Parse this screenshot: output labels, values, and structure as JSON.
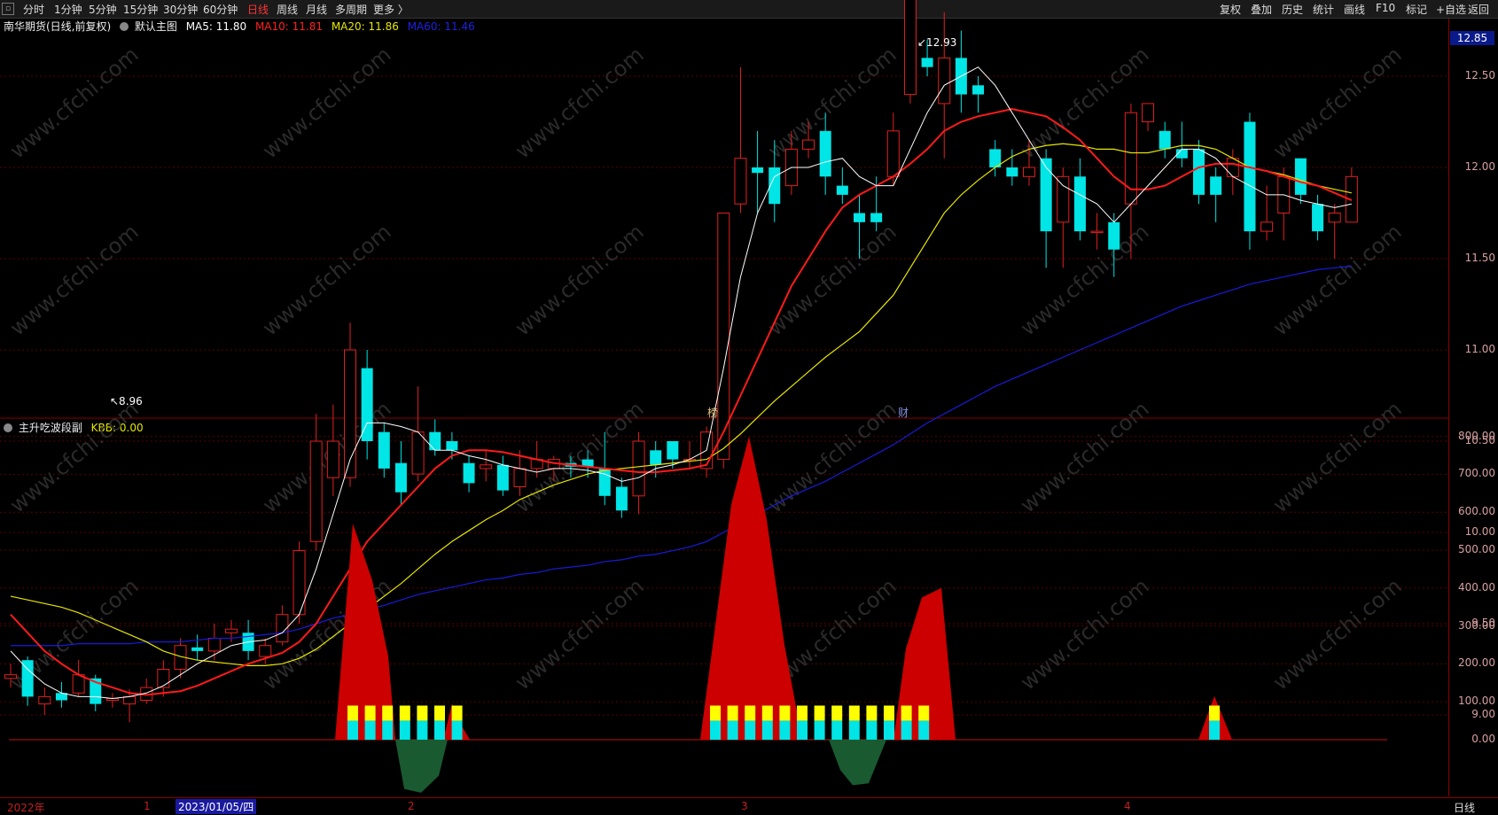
{
  "toolbar": {
    "left_items": [
      "分时",
      "1分钟",
      "5分钟",
      "15分钟",
      "30分钟",
      "60分钟",
      "日线",
      "周线",
      "月线",
      "多周期",
      "更多 〉"
    ],
    "active": "日线",
    "right_items": [
      "复权",
      "叠加",
      "历史",
      "统计",
      "画线",
      "F10",
      "标记",
      "+自选",
      "返回"
    ]
  },
  "main_chart": {
    "title": "南华期货(日线,前复权)",
    "indicator_name": "默认主图",
    "ma5": "MA5: 11.80",
    "ma10": "MA10: 11.81",
    "ma20": "MA20: 11.86",
    "ma60": "MA60: 11.46",
    "high_label": "12.93",
    "low_label": "8.96",
    "current_price": "12.85",
    "y_ticks": [
      "12.50",
      "12.00",
      "11.50",
      "11.00",
      "10.50",
      "10.00",
      "9.50",
      "9.00"
    ],
    "markers": [
      "榜",
      "财"
    ],
    "colors": {
      "up": "#e02020",
      "down": "#00e5e5",
      "ma5": "#ffffff",
      "ma10": "#ff1a1a",
      "ma20": "#e6e600",
      "ma60": "#1a1adb"
    }
  },
  "sub_chart": {
    "title": "主升吃波段副",
    "kbb": "KBB: 0.00",
    "y_ticks": [
      "800.00",
      "700.00",
      "600.00",
      "500.00",
      "400.00",
      "300.00",
      "200.00",
      "100.00",
      "0.00"
    ]
  },
  "time_axis": {
    "year": "2022年",
    "labels": [
      "1",
      "2",
      "3",
      "4"
    ],
    "selected_date": "2023/01/05/四",
    "period": "日线"
  },
  "watermark": "www.cfchi.com",
  "candles": [
    [
      9.2,
      9.22,
      9.15,
      9.28
    ],
    [
      9.3,
      9.1,
      9.05,
      9.32
    ],
    [
      9.06,
      9.1,
      9.0,
      9.15
    ],
    [
      9.12,
      9.08,
      9.04,
      9.18
    ],
    [
      9.12,
      9.22,
      9.1,
      9.3
    ],
    [
      9.2,
      9.06,
      9.02,
      9.22
    ],
    [
      9.08,
      9.09,
      9.04,
      9.12
    ],
    [
      9.06,
      9.1,
      8.96,
      9.14
    ],
    [
      9.08,
      9.15,
      9.06,
      9.2
    ],
    [
      9.15,
      9.25,
      9.1,
      9.3
    ],
    [
      9.25,
      9.38,
      9.2,
      9.42
    ],
    [
      9.37,
      9.35,
      9.3,
      9.44
    ],
    [
      9.35,
      9.42,
      9.3,
      9.5
    ],
    [
      9.45,
      9.47,
      9.4,
      9.52
    ],
    [
      9.45,
      9.35,
      9.3,
      9.52
    ],
    [
      9.32,
      9.38,
      9.28,
      9.42
    ],
    [
      9.4,
      9.55,
      9.38,
      9.6
    ],
    [
      9.55,
      9.9,
      9.5,
      9.95
    ],
    [
      9.95,
      10.5,
      9.9,
      10.65
    ],
    [
      10.3,
      10.5,
      10.2,
      10.7
    ],
    [
      10.3,
      11.0,
      10.25,
      11.15
    ],
    [
      10.9,
      10.5,
      10.4,
      11.0
    ],
    [
      10.55,
      10.35,
      10.3,
      10.6
    ],
    [
      10.38,
      10.22,
      10.15,
      10.5
    ],
    [
      10.32,
      10.55,
      10.28,
      10.8
    ],
    [
      10.55,
      10.45,
      10.42,
      10.62
    ],
    [
      10.5,
      10.45,
      10.4,
      10.55
    ],
    [
      10.38,
      10.27,
      10.22,
      10.42
    ],
    [
      10.35,
      10.37,
      10.28,
      10.45
    ],
    [
      10.37,
      10.23,
      10.2,
      10.42
    ],
    [
      10.25,
      10.35,
      10.2,
      10.45
    ],
    [
      10.35,
      10.4,
      10.3,
      10.5
    ],
    [
      10.35,
      10.4,
      10.28,
      10.42
    ],
    [
      10.38,
      10.36,
      10.3,
      10.42
    ],
    [
      10.4,
      10.36,
      10.3,
      10.45
    ],
    [
      10.35,
      10.2,
      10.15,
      10.55
    ],
    [
      10.25,
      10.12,
      10.08,
      10.3
    ],
    [
      10.2,
      10.5,
      10.1,
      10.55
    ],
    [
      10.45,
      10.37,
      10.3,
      10.5
    ],
    [
      10.5,
      10.4,
      10.35,
      10.5
    ],
    [
      10.4,
      10.4,
      10.35,
      10.5
    ],
    [
      10.35,
      10.55,
      10.3,
      10.58
    ],
    [
      10.4,
      11.75,
      10.35,
      11.75
    ],
    [
      11.8,
      12.05,
      11.75,
      12.55
    ],
    [
      12.0,
      11.97,
      11.75,
      12.2
    ],
    [
      12.0,
      11.8,
      11.7,
      12.15
    ],
    [
      11.9,
      12.1,
      11.85,
      12.2
    ],
    [
      12.1,
      12.15,
      12.05,
      12.25
    ],
    [
      12.2,
      11.95,
      11.85,
      12.3
    ],
    [
      11.9,
      11.85,
      11.8,
      12.0
    ],
    [
      11.75,
      11.7,
      11.5,
      11.85
    ],
    [
      11.75,
      11.7,
      11.65,
      11.95
    ],
    [
      11.95,
      12.2,
      11.9,
      12.3
    ],
    [
      12.4,
      12.93,
      12.35,
      12.93
    ],
    [
      12.6,
      12.55,
      12.5,
      12.7
    ],
    [
      12.35,
      12.6,
      12.05,
      12.85
    ],
    [
      12.6,
      12.4,
      12.3,
      12.75
    ],
    [
      12.45,
      12.4,
      12.3,
      12.5
    ],
    [
      12.1,
      12.0,
      11.95,
      12.15
    ],
    [
      12.0,
      11.95,
      11.9,
      12.1
    ],
    [
      11.95,
      12.0,
      11.9,
      12.15
    ],
    [
      12.05,
      11.65,
      11.45,
      12.1
    ],
    [
      11.7,
      11.95,
      11.45,
      12.0
    ],
    [
      11.95,
      11.65,
      11.6,
      12.05
    ],
    [
      11.65,
      11.65,
      11.55,
      11.75
    ],
    [
      11.7,
      11.55,
      11.4,
      11.75
    ],
    [
      11.8,
      12.3,
      11.5,
      12.35
    ],
    [
      12.25,
      12.35,
      12.2,
      12.35
    ],
    [
      12.2,
      12.1,
      12.05,
      12.25
    ],
    [
      12.1,
      12.05,
      12.0,
      12.25
    ],
    [
      12.1,
      11.85,
      11.8,
      12.15
    ],
    [
      11.95,
      11.85,
      11.7,
      12.0
    ],
    [
      11.95,
      12.05,
      11.85,
      12.1
    ],
    [
      12.25,
      11.65,
      11.55,
      12.3
    ],
    [
      11.65,
      11.7,
      11.6,
      11.9
    ],
    [
      11.75,
      11.95,
      11.6,
      12.0
    ],
    [
      12.05,
      11.85,
      11.8,
      12.05
    ],
    [
      11.8,
      11.65,
      11.6,
      11.85
    ],
    [
      11.7,
      11.75,
      11.5,
      11.8
    ],
    [
      11.7,
      11.95,
      11.7,
      12.0
    ]
  ],
  "ma5": [
    9.35,
    9.25,
    9.17,
    9.12,
    9.1,
    9.1,
    9.09,
    9.1,
    9.12,
    9.16,
    9.22,
    9.28,
    9.33,
    9.38,
    9.4,
    9.41,
    9.45,
    9.55,
    9.8,
    10.1,
    10.4,
    10.6,
    10.6,
    10.58,
    10.55,
    10.45,
    10.45,
    10.42,
    10.4,
    10.37,
    10.35,
    10.33,
    10.35,
    10.35,
    10.34,
    10.32,
    10.28,
    10.3,
    10.35,
    10.37,
    10.4,
    10.45,
    10.9,
    11.4,
    11.75,
    11.95,
    12.0,
    12.0,
    12.03,
    12.05,
    11.95,
    11.9,
    11.9,
    12.1,
    12.3,
    12.45,
    12.5,
    12.55,
    12.45,
    12.3,
    12.15,
    12.0,
    11.9,
    11.85,
    11.8,
    11.7,
    11.8,
    11.9,
    12.0,
    12.1,
    12.1,
    12.05,
    11.95,
    11.9,
    11.85,
    11.85,
    11.82,
    11.8,
    11.78,
    11.8
  ],
  "ma10": [
    9.55,
    9.45,
    9.35,
    9.28,
    9.22,
    9.18,
    9.15,
    9.12,
    9.11,
    9.12,
    9.13,
    9.16,
    9.2,
    9.24,
    9.28,
    9.31,
    9.34,
    9.4,
    9.5,
    9.65,
    9.8,
    9.95,
    10.05,
    10.15,
    10.25,
    10.35,
    10.42,
    10.45,
    10.45,
    10.44,
    10.42,
    10.4,
    10.38,
    10.37,
    10.36,
    10.35,
    10.34,
    10.33,
    10.33,
    10.34,
    10.35,
    10.37,
    10.55,
    10.75,
    10.95,
    11.15,
    11.35,
    11.5,
    11.65,
    11.78,
    11.85,
    11.9,
    11.95,
    12.02,
    12.1,
    12.2,
    12.25,
    12.28,
    12.3,
    12.32,
    12.3,
    12.28,
    12.22,
    12.15,
    12.05,
    11.95,
    11.88,
    11.88,
    11.9,
    11.95,
    12.0,
    12.02,
    12.02,
    12.0,
    11.98,
    11.95,
    11.92,
    11.9,
    11.86,
    11.82
  ],
  "ma20": [
    9.65,
    9.63,
    9.61,
    9.59,
    9.56,
    9.52,
    9.48,
    9.44,
    9.4,
    9.35,
    9.32,
    9.3,
    9.29,
    9.28,
    9.27,
    9.27,
    9.28,
    9.31,
    9.36,
    9.43,
    9.5,
    9.58,
    9.65,
    9.72,
    9.8,
    9.88,
    9.95,
    10.01,
    10.07,
    10.12,
    10.18,
    10.22,
    10.26,
    10.29,
    10.32,
    10.34,
    10.35,
    10.36,
    10.37,
    10.38,
    10.39,
    10.4,
    10.46,
    10.54,
    10.63,
    10.72,
    10.8,
    10.88,
    10.96,
    11.03,
    11.1,
    11.2,
    11.3,
    11.45,
    11.6,
    11.75,
    11.85,
    11.93,
    12.0,
    12.06,
    12.1,
    12.12,
    12.13,
    12.12,
    12.1,
    12.1,
    12.08,
    12.08,
    12.1,
    12.12,
    12.12,
    12.1,
    12.05,
    12.0,
    11.98,
    11.96,
    11.93,
    11.9,
    11.88,
    11.86
  ],
  "ma60": [
    9.38,
    9.38,
    9.38,
    9.38,
    9.39,
    9.39,
    9.39,
    9.39,
    9.4,
    9.4,
    9.4,
    9.41,
    9.42,
    9.42,
    9.43,
    9.44,
    9.45,
    9.47,
    9.5,
    9.53,
    9.55,
    9.58,
    9.6,
    9.63,
    9.66,
    9.68,
    9.7,
    9.72,
    9.74,
    9.75,
    9.77,
    9.78,
    9.8,
    9.81,
    9.82,
    9.84,
    9.85,
    9.87,
    9.88,
    9.9,
    9.92,
    9.95,
    10.0,
    10.05,
    10.1,
    10.15,
    10.2,
    10.24,
    10.28,
    10.33,
    10.38,
    10.43,
    10.48,
    10.54,
    10.6,
    10.65,
    10.7,
    10.75,
    10.8,
    10.84,
    10.88,
    10.92,
    10.96,
    11.0,
    11.04,
    11.08,
    11.12,
    11.16,
    11.2,
    11.24,
    11.27,
    11.3,
    11.33,
    11.36,
    11.38,
    11.4,
    11.42,
    11.44,
    11.45,
    11.46
  ]
}
